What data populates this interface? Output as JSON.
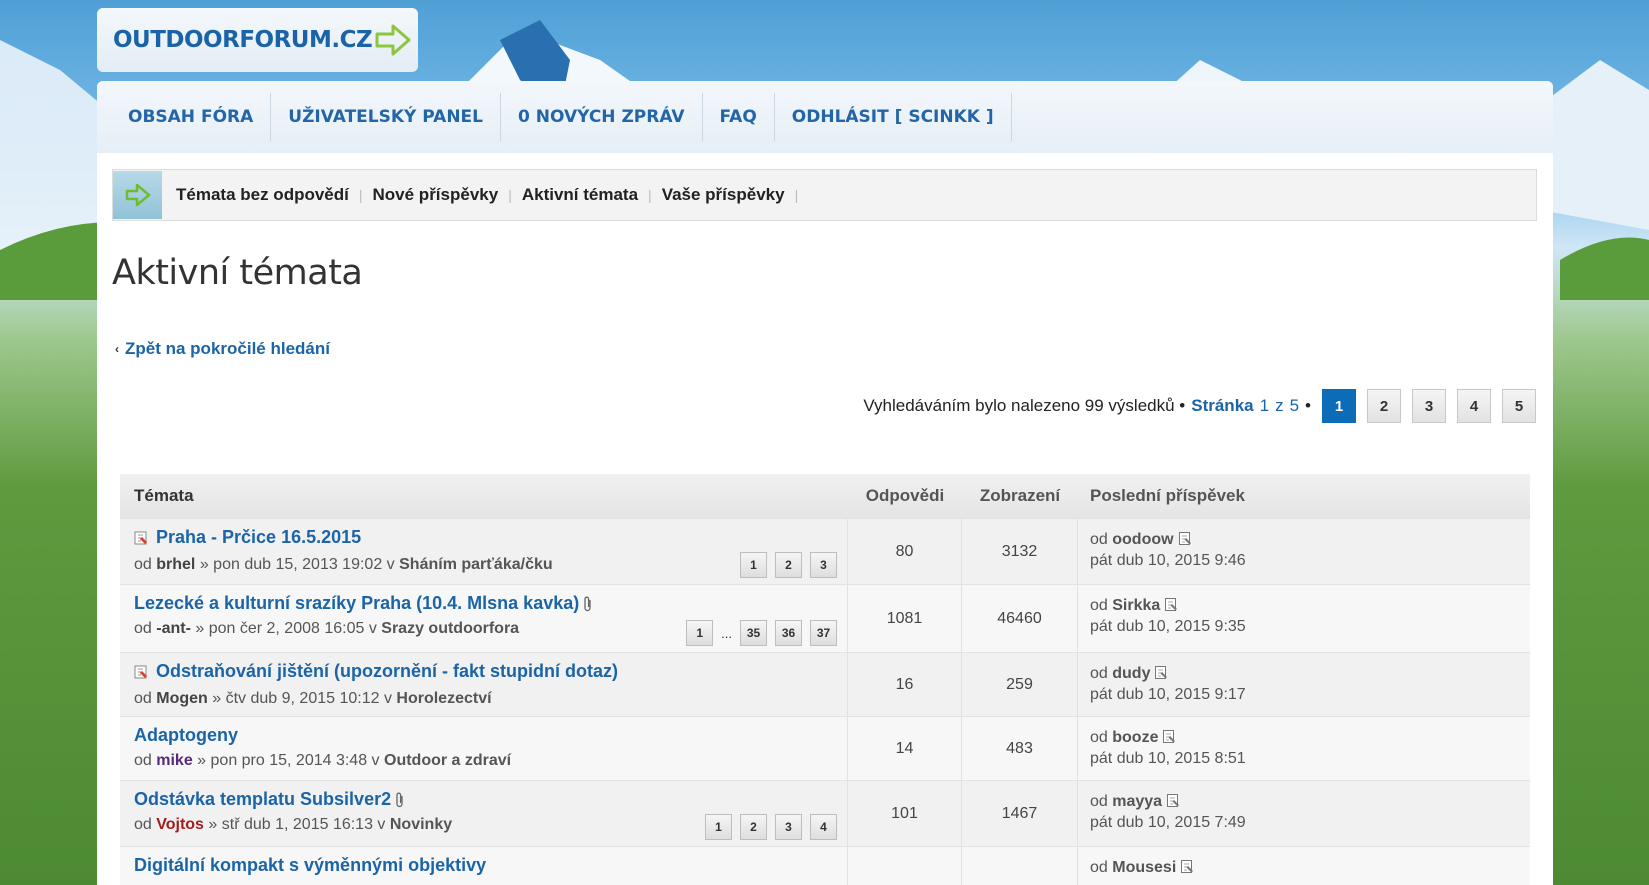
{
  "logo": {
    "text": "OUTDOORFORUM.CZ"
  },
  "nav": [
    {
      "label": "OBSAH FÓRA"
    },
    {
      "label": "UŽIVATELSKÝ PANEL"
    },
    {
      "label": "0 NOVÝCH ZPRÁV"
    },
    {
      "label": "FAQ"
    },
    {
      "label": "ODHLÁSIT [ SCINKK ]"
    }
  ],
  "quicklinks": [
    {
      "label": "Témata bez odpovědí"
    },
    {
      "label": "Nové příspěvky"
    },
    {
      "label": "Aktivní témata"
    },
    {
      "label": "Vaše příspěvky"
    }
  ],
  "page_title": "Aktivní témata",
  "back_link": "Zpět na pokročilé hledání",
  "pagination": {
    "summary": "Vyhledáváním bylo nalezeno 99 výsledků •",
    "stranka": "Stránka",
    "current": "1",
    "z": "z",
    "total": "5",
    "bullet": "•",
    "pages": [
      "1",
      "2",
      "3",
      "4",
      "5"
    ]
  },
  "table": {
    "headers": {
      "title": "Témata",
      "replies": "Odpovědi",
      "views": "Zobrazení",
      "last": "Poslední příspěvek"
    },
    "rows": [
      {
        "title": "Praha - Prčice 16.5.2015",
        "hot": true,
        "attach": false,
        "od": "od",
        "author": "brhel",
        "author_style": "plain",
        "date": "» pon dub 15, 2013 19:02 v",
        "forum": "Sháním parťáka/čku",
        "pages": [
          "1",
          "2",
          "3"
        ],
        "replies": "80",
        "views": "3132",
        "last_od": "od",
        "last_user": "oodoow",
        "last_date": "pát dub 10, 2015 9:46"
      },
      {
        "title": "Lezecké a kulturní srazíky Praha (10.4. Mlsna kavka)",
        "hot": false,
        "attach": true,
        "od": "od",
        "author": "-ant-",
        "author_style": "plain",
        "date": "» pon čer 2, 2008 16:05 v",
        "forum": "Srazy outdoorfora",
        "pages": [
          "1",
          "...",
          "35",
          "36",
          "37"
        ],
        "replies": "1081",
        "views": "46460",
        "last_od": "od",
        "last_user": "Sirkka",
        "last_date": "pát dub 10, 2015 9:35"
      },
      {
        "title": "Odstraňování jištění (upozornění - fakt stupidní dotaz)",
        "hot": true,
        "attach": false,
        "od": "od",
        "author": "Mogen",
        "author_style": "plain",
        "date": "» čtv dub 9, 2015 10:12 v",
        "forum": "Horolezectví",
        "pages": [],
        "replies": "16",
        "views": "259",
        "last_od": "od",
        "last_user": "dudy",
        "last_date": "pát dub 10, 2015 9:17"
      },
      {
        "title": "Adaptogeny",
        "hot": false,
        "attach": false,
        "od": "od",
        "author": "mike",
        "author_style": "purple",
        "date": "» pon pro 15, 2014 3:48 v",
        "forum": "Outdoor a zdraví",
        "pages": [],
        "replies": "14",
        "views": "483",
        "last_od": "od",
        "last_user": "booze",
        "last_date": "pát dub 10, 2015 8:51"
      },
      {
        "title": "Odstávka templatu Subsilver2",
        "hot": false,
        "attach": true,
        "od": "od",
        "author": "Vojtos",
        "author_style": "red",
        "date": "» stř dub 1, 2015 16:13 v",
        "forum": "Novinky",
        "pages": [
          "1",
          "2",
          "3",
          "4"
        ],
        "replies": "101",
        "views": "1467",
        "last_od": "od",
        "last_user": "mayya",
        "last_date": "pát dub 10, 2015 7:49"
      },
      {
        "title": "Digitální kompakt s výměnnými objektivy",
        "hot": false,
        "attach": false,
        "od": "",
        "author": "",
        "author_style": "plain",
        "date": "",
        "forum": "",
        "pages": [],
        "replies": "",
        "views": "",
        "last_od": "od",
        "last_user": "Mousesi",
        "last_date": ""
      }
    ]
  },
  "colors": {
    "accent": "#1b64a8",
    "active_page": "#0c6cb8",
    "nav_text": "#1b5fa3"
  }
}
